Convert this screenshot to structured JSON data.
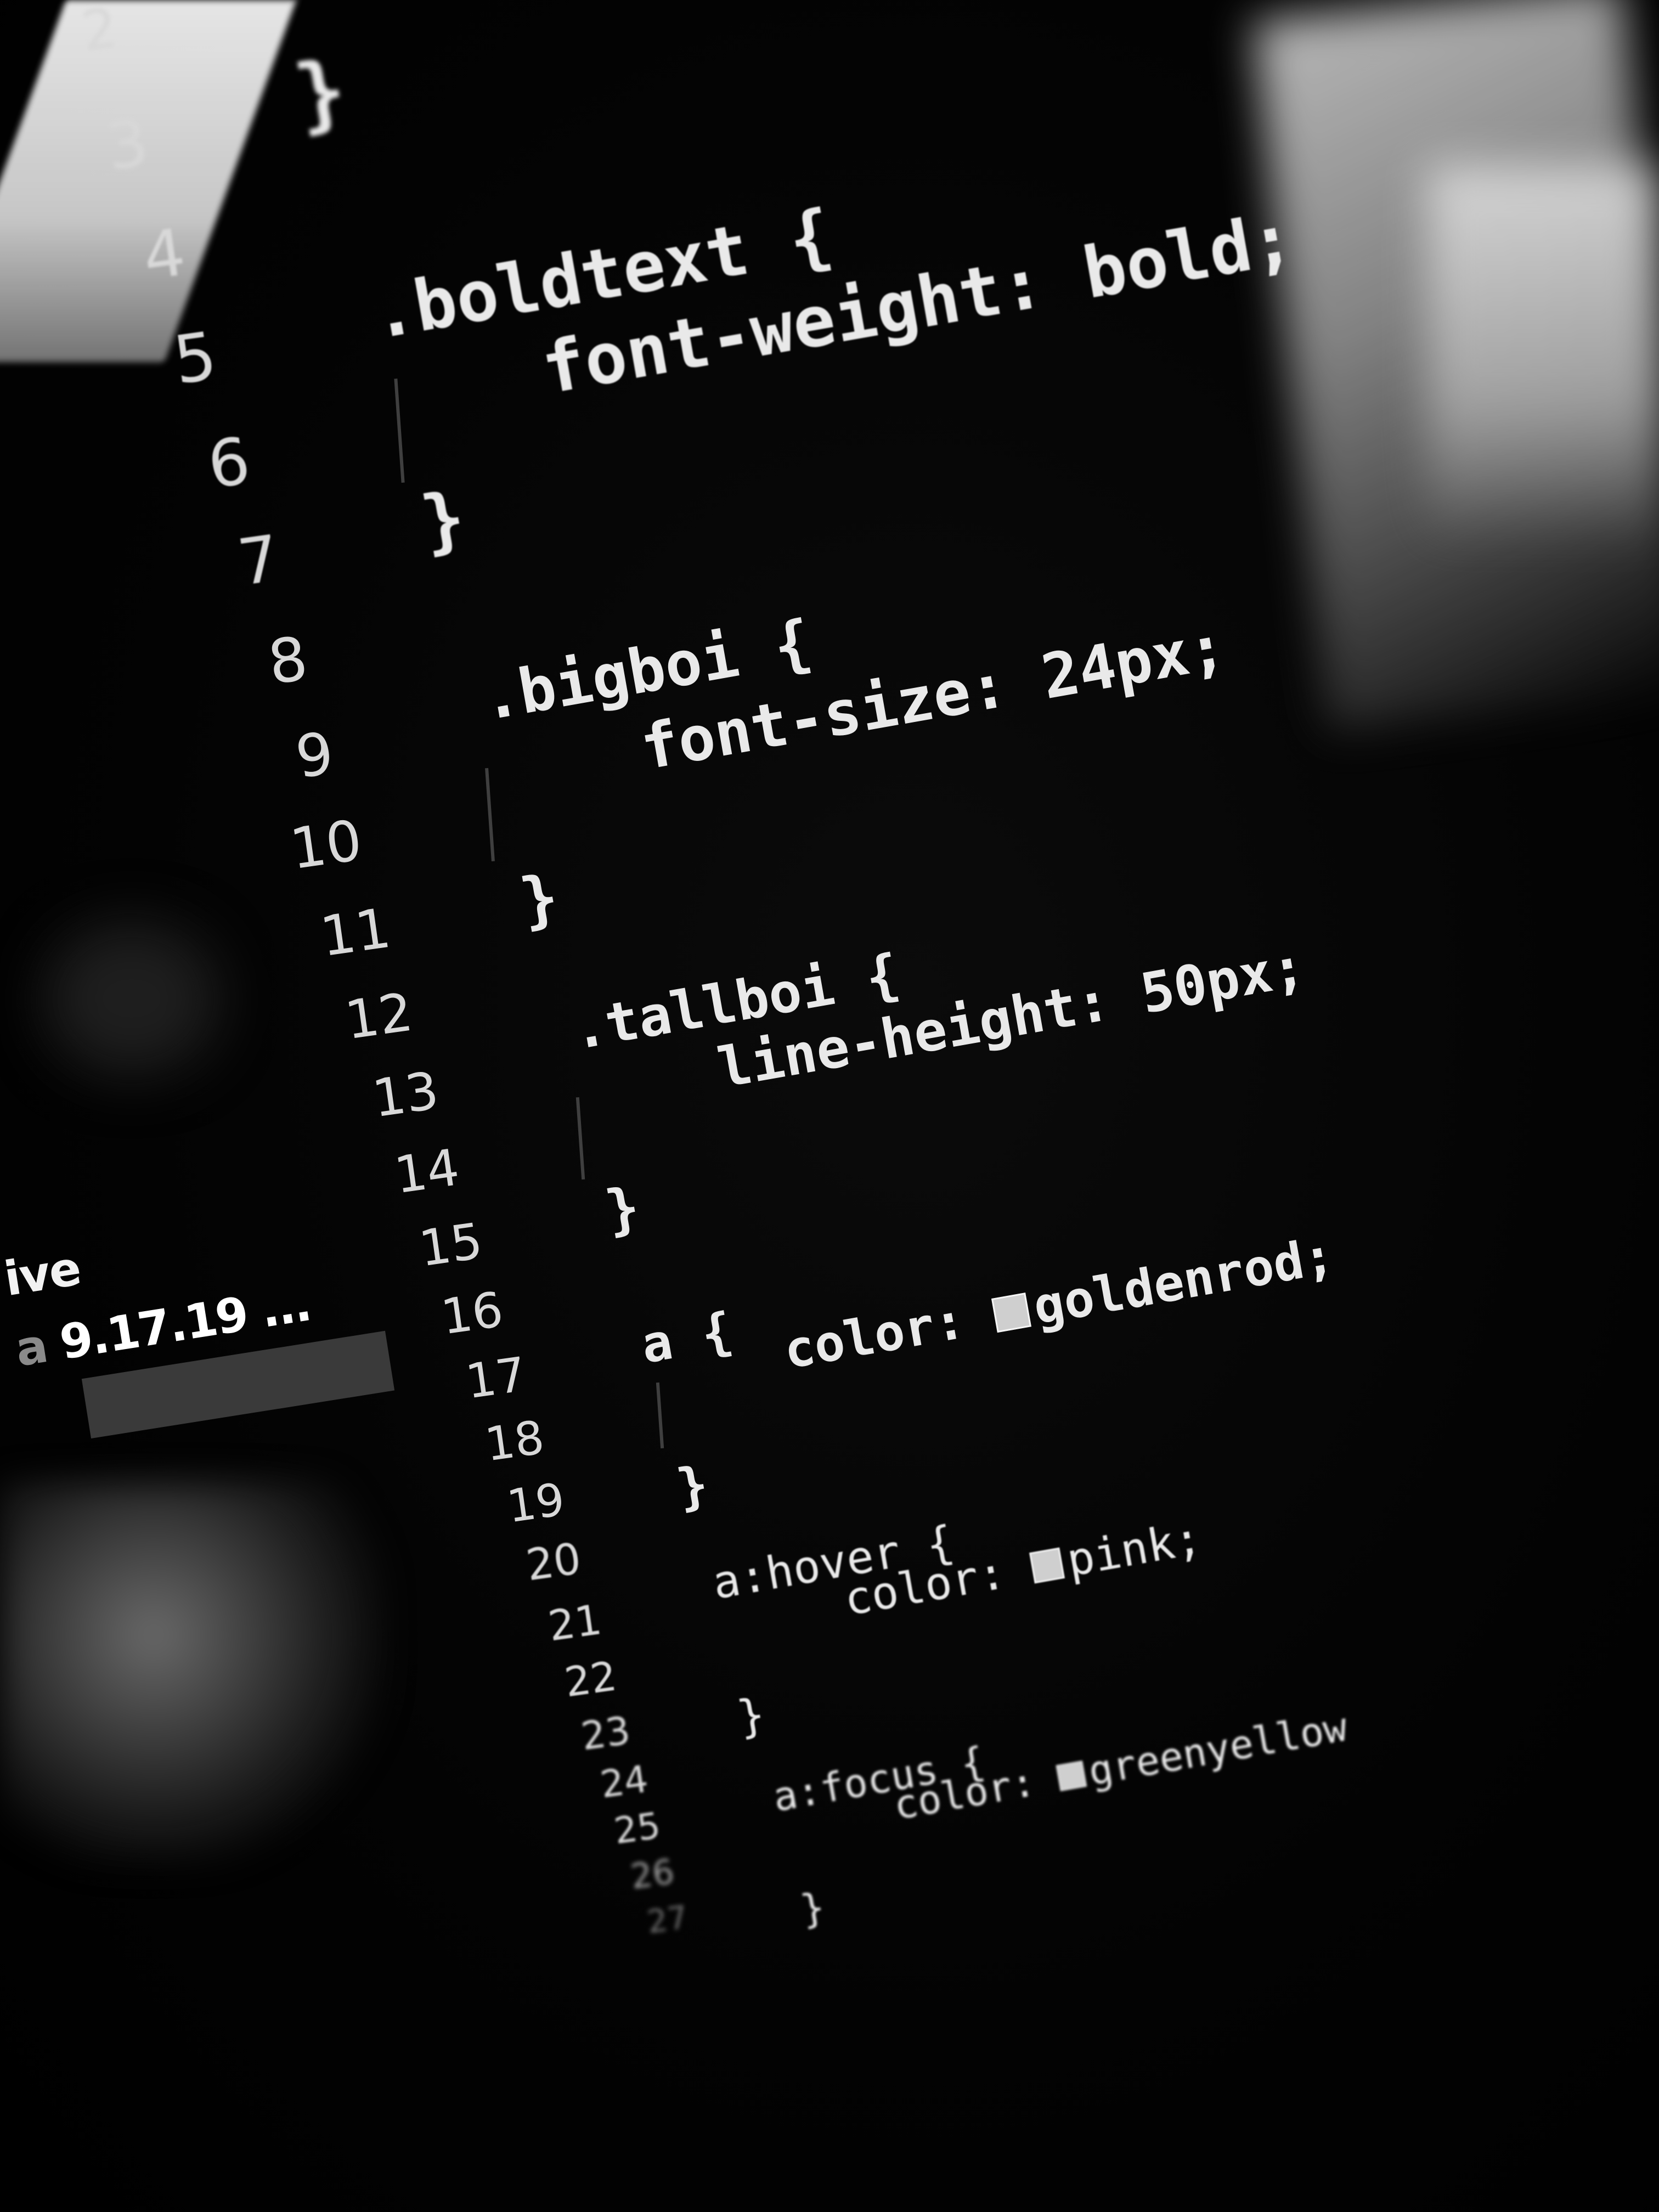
{
  "sidebar": {
    "item_label": "ive",
    "item_subtitle_prefix": "a",
    "item_subtitle": "9.17.19 ..."
  },
  "editor": {
    "line_numbers": [
      "2",
      "3",
      "4",
      "5",
      "6",
      "7",
      "8",
      "9",
      "10",
      "11",
      "12",
      "13",
      "14",
      "15",
      "16",
      "17",
      "18",
      "19",
      "20",
      "21",
      "22",
      "23",
      "24",
      "25",
      "26",
      "27"
    ],
    "lines": [
      {
        "n": "3",
        "text": "}"
      },
      {
        "n": "5",
        "text": ".boldtext {"
      },
      {
        "n": "5b",
        "text": "font-weight: bold;"
      },
      {
        "n": "7",
        "text": "}"
      },
      {
        "n": "9",
        "text": ".bigboi {"
      },
      {
        "n": "9b",
        "text": "font-size: 24px;"
      },
      {
        "n": "11",
        "text": "}"
      },
      {
        "n": "13",
        "text": ".tallboi {"
      },
      {
        "n": "13b",
        "text": "line-height: 50px;"
      },
      {
        "n": "15",
        "text": "}"
      },
      {
        "n": "17",
        "text": "a {"
      },
      {
        "n": "17b",
        "text": "color: ",
        "value": "goldenrod;"
      },
      {
        "n": "19",
        "text": "}"
      },
      {
        "n": "21",
        "text": "a:hover {"
      },
      {
        "n": "21b",
        "text": "color: ",
        "value": "pink;"
      },
      {
        "n": "23",
        "text": "}"
      },
      {
        "n": "25",
        "text": "a:focus {"
      },
      {
        "n": "25b",
        "text": "color: ",
        "value": "greenyellow"
      },
      {
        "n": "27",
        "text": "}"
      }
    ]
  },
  "colors": {
    "background": "#050505",
    "code_text": "#e9e9e9",
    "line_number": "#d8d8d8",
    "swatch": "#cfcfcf",
    "selection": "#3a3a3a"
  }
}
